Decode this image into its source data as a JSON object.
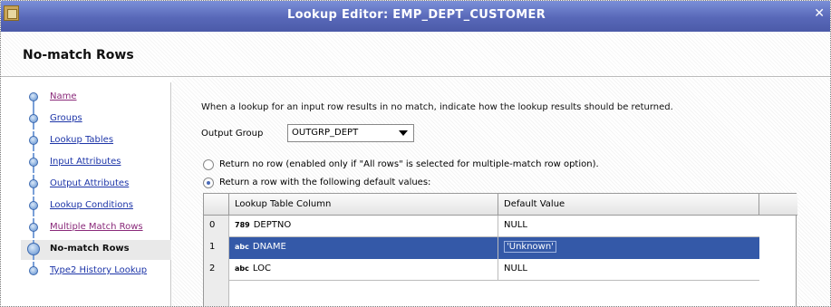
{
  "window": {
    "title": "Lookup Editor: EMP_DEPT_CUSTOMER",
    "close_glyph": "✕"
  },
  "page": {
    "title": "No-match Rows"
  },
  "nav": {
    "items": [
      {
        "label": "Name",
        "state": "visited"
      },
      {
        "label": "Groups",
        "state": "link"
      },
      {
        "label": "Lookup Tables",
        "state": "link"
      },
      {
        "label": "Input Attributes",
        "state": "link"
      },
      {
        "label": "Output Attributes",
        "state": "link"
      },
      {
        "label": "Lookup Conditions",
        "state": "link"
      },
      {
        "label": "Multiple Match Rows",
        "state": "visited"
      },
      {
        "label": "No-match Rows",
        "state": "current"
      },
      {
        "label": "Type2 History Lookup",
        "state": "link"
      }
    ]
  },
  "content": {
    "intro": "When a lookup for an input row results in no match, indicate how the lookup results should be returned.",
    "output_group_label": "Output Group",
    "output_group_value": "OUTGRP_DEPT",
    "radio_no_row": "Return no row (enabled only if \"All rows\" is selected for multiple-match row option).",
    "radio_default_row": "Return a row with the following default values:",
    "selected_option": "default_row"
  },
  "grid": {
    "columns": [
      "Lookup Table Column",
      "Default Value"
    ],
    "rows": [
      {
        "num": "0",
        "type_icon": "789",
        "column": "DEPTNO",
        "default": "NULL",
        "selected": false
      },
      {
        "num": "1",
        "type_icon": "abc",
        "column": "DNAME",
        "default": "'Unknown'",
        "selected": true
      },
      {
        "num": "2",
        "type_icon": "abc",
        "column": "LOC",
        "default": "NULL",
        "selected": false
      }
    ]
  },
  "colors": {
    "title_bar": "#5868b8",
    "selection": "#3459a8",
    "link": "#1d35a8",
    "visited_link": "#8a2a7a"
  }
}
